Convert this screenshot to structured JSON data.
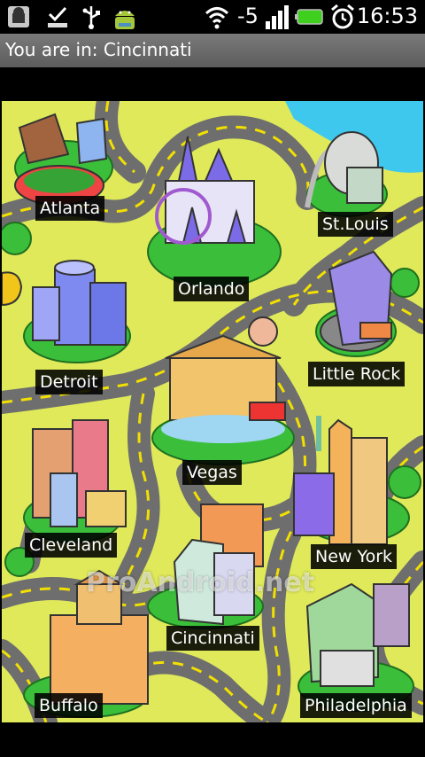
{
  "status_bar": {
    "time": "16:53",
    "signal_strength_text": "-5",
    "icons": [
      "android-debug-icon",
      "download-complete-icon",
      "usb-icon",
      "android-robot-icon",
      "wifi-icon",
      "signal-bars-icon",
      "battery-icon",
      "alarm-clock-icon"
    ]
  },
  "title_bar": {
    "text": "You are in: Cincinnati"
  },
  "map": {
    "watermark": "ProAndroid.net",
    "cities": [
      {
        "id": "atlanta",
        "label": "Atlanta"
      },
      {
        "id": "orlando",
        "label": "Orlando"
      },
      {
        "id": "stlouis",
        "label": "St.Louis"
      },
      {
        "id": "detroit",
        "label": "Detroit"
      },
      {
        "id": "littlerock",
        "label": "Little Rock"
      },
      {
        "id": "vegas",
        "label": "Vegas"
      },
      {
        "id": "cleveland",
        "label": "Cleveland"
      },
      {
        "id": "newyork",
        "label": "New York"
      },
      {
        "id": "cincinnati",
        "label": "Cincinnati"
      },
      {
        "id": "buffalo",
        "label": "Buffalo"
      },
      {
        "id": "philadelphia",
        "label": "Philadelphia"
      }
    ]
  },
  "colors": {
    "grass": "#dfe95a",
    "road": "#777777",
    "road_dash": "#f2e000",
    "bush": "#3bbf3b",
    "water": "#3fc8ee"
  }
}
